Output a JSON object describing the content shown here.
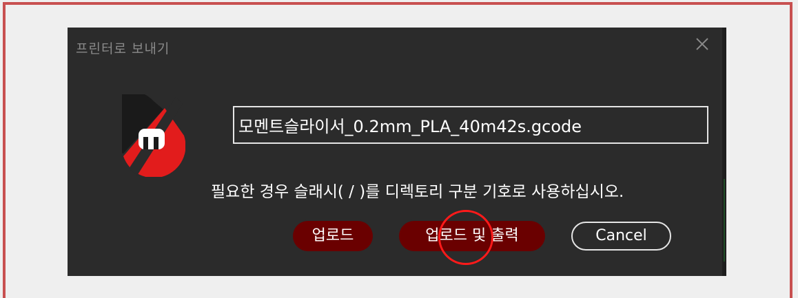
{
  "dialog": {
    "title": "프린터로 보내기",
    "filename_value": "모멘트슬라이서_0.2mm_PLA_40m42s.gcode",
    "hint": "필요한 경우 슬래시( / )를 디렉토리 구분 기호로 사용하십시오.",
    "buttons": {
      "upload": "업로드",
      "upload_and_print": "업로드 및 출력",
      "cancel": "Cancel"
    }
  },
  "icons": {
    "close": "close-icon",
    "logo": "app-logo"
  },
  "colors": {
    "dialog_bg": "#2b2b2b",
    "button_red": "#6a0000",
    "accent_red": "#e02020",
    "annotation_red": "#ff1a1a",
    "frame_border": "#c85050"
  }
}
